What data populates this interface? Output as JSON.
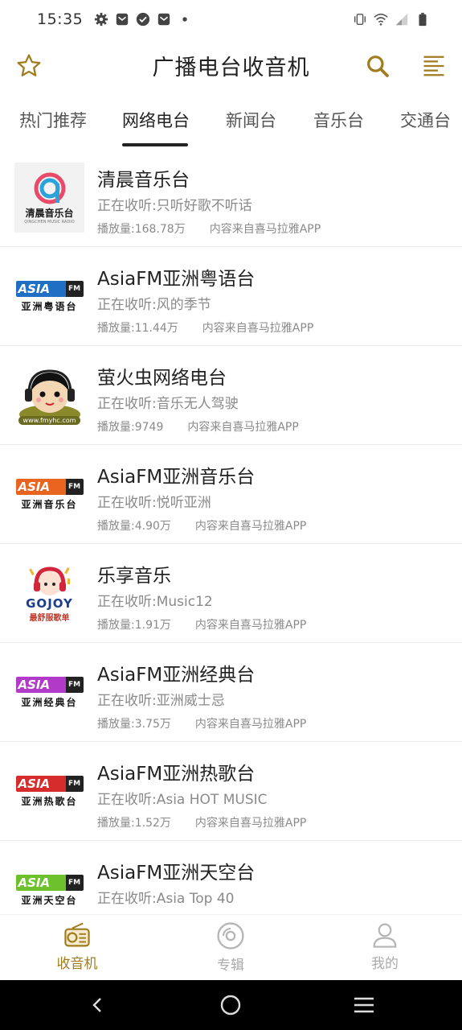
{
  "status_bar": {
    "time": "15:35",
    "left_icons": [
      "gear-icon",
      "mail-icon",
      "check-circle-icon",
      "mail-icon",
      "dot-icon"
    ],
    "right_icons": [
      "vibrate-icon",
      "wifi-icon",
      "signal-icon",
      "battery-icon"
    ]
  },
  "header": {
    "title": "广播电台收音机",
    "icons": [
      "star-icon",
      "search-icon",
      "menu-icon"
    ]
  },
  "tabs": [
    {
      "label": "热门推荐",
      "active": false
    },
    {
      "label": "网络电台",
      "active": true
    },
    {
      "label": "新闻台",
      "active": false
    },
    {
      "label": "音乐台",
      "active": false
    },
    {
      "label": "交通台",
      "active": false
    }
  ],
  "stations": [
    {
      "title": "清晨音乐台",
      "now_playing": "正在收听:只听好歌不听话",
      "plays": "播放量:168.78万",
      "source": "内容来自喜马拉雅APP",
      "logo_text": "清晨音乐台",
      "logo_small": "QINGCHEN MUSIC RADIO"
    },
    {
      "title": "AsiaFM亚洲粤语台",
      "now_playing": "正在收听:风的季节",
      "plays": "播放量:11.44万",
      "source": "内容来自喜马拉雅APP",
      "logo_asia": "ASIA",
      "logo_fm": "FM",
      "logo_cn": "亚洲粤语台",
      "logo_color": "#1f6fc4"
    },
    {
      "title": "萤火虫网络电台",
      "now_playing": "正在收听:音乐无人驾驶",
      "plays": "播放量:9749",
      "source": "内容来自喜马拉雅APP",
      "logo_url": "www.fmyhc.com"
    },
    {
      "title": "AsiaFM亚洲音乐台",
      "now_playing": "正在收听:悦听亚洲",
      "plays": "播放量:4.90万",
      "source": "内容来自喜马拉雅APP",
      "logo_asia": "ASIA",
      "logo_fm": "FM",
      "logo_cn": "亚洲音乐台",
      "logo_color": "#e8641f"
    },
    {
      "title": "乐享音乐",
      "now_playing": "正在收听:Music12",
      "plays": "播放量:1.91万",
      "source": "内容来自喜马拉雅APP",
      "logo_text": "GOJOY",
      "logo_cn": "最舒服歌单"
    },
    {
      "title": "AsiaFM亚洲经典台",
      "now_playing": "正在收听:亚洲威士忌",
      "plays": "播放量:3.75万",
      "source": "内容来自喜马拉雅APP",
      "logo_asia": "ASIA",
      "logo_fm": "FM",
      "logo_cn": "亚洲经典台",
      "logo_color": "#b23ac9"
    },
    {
      "title": "AsiaFM亚洲热歌台",
      "now_playing": "正在收听:Asia HOT MUSIC",
      "plays": "播放量:1.52万",
      "source": "内容来自喜马拉雅APP",
      "logo_asia": "ASIA",
      "logo_fm": "FM",
      "logo_cn": "亚洲热歌台",
      "logo_color": "#d62c2c"
    },
    {
      "title": "AsiaFM亚洲天空台",
      "now_playing": "正在收听:Asia Top 40",
      "plays": "",
      "source": "",
      "logo_asia": "ASIA",
      "logo_fm": "FM",
      "logo_cn": "亚洲天空台",
      "logo_color": "#6cc12d"
    }
  ],
  "bottom_nav": [
    {
      "label": "收音机",
      "icon": "radio-icon",
      "active": true
    },
    {
      "label": "专辑",
      "icon": "disc-icon",
      "active": false
    },
    {
      "label": "我的",
      "icon": "person-icon",
      "active": false
    }
  ],
  "system_nav": [
    "back-icon",
    "home-icon",
    "recents-icon"
  ],
  "colors": {
    "accent": "#a07c1e",
    "text": "#222222",
    "muted": "#8a8a8a",
    "divider": "#ececec"
  }
}
